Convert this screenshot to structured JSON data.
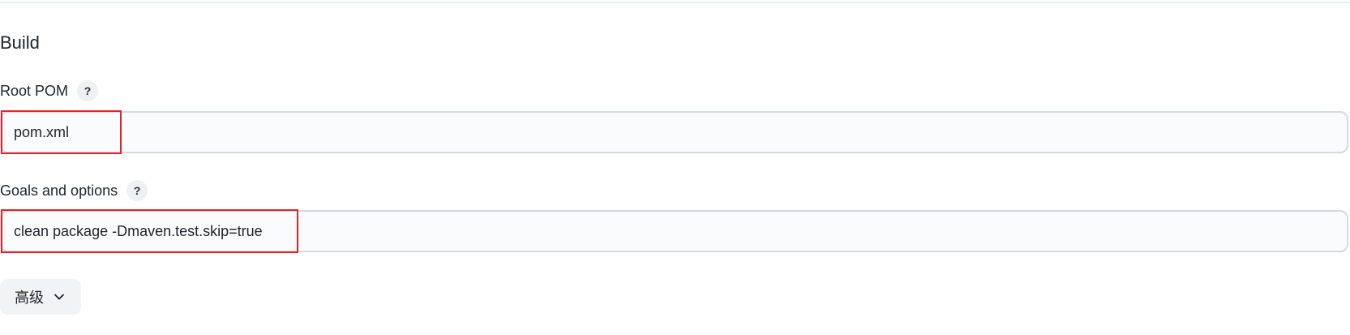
{
  "section": {
    "title": "Build"
  },
  "root_pom": {
    "label": "Root POM",
    "help": "?",
    "value": "pom.xml"
  },
  "goals": {
    "label": "Goals and options",
    "help": "?",
    "value": "clean package -Dmaven.test.skip=true"
  },
  "advanced": {
    "label": "高级",
    "icon": "chevron-down-icon"
  },
  "colors": {
    "highlight": "#e32227",
    "input_border": "#d5dae1",
    "help_bg": "#eef0f3"
  }
}
